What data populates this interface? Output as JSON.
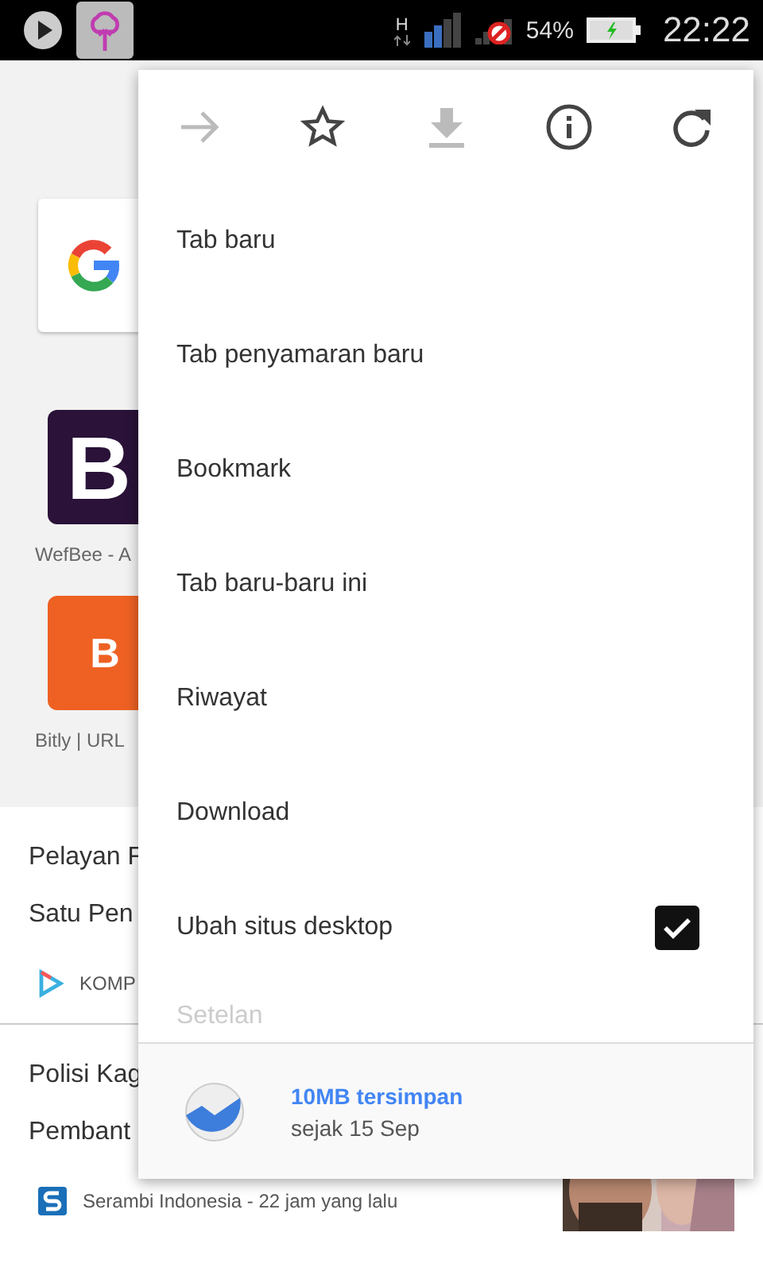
{
  "status_bar": {
    "network": "H",
    "battery": "54%",
    "time": "22:22"
  },
  "tiles": [
    {
      "kind": "google"
    },
    {
      "kind": "letter",
      "letter": "B",
      "color": "#2a1238",
      "label": "WefBee - A"
    },
    {
      "kind": "letter",
      "letter": "B",
      "color": "#ee6123",
      "label": "Bitly | URL"
    }
  ],
  "articles": [
    {
      "lines": [
        "Pelayan F",
        "Satu Pen"
      ],
      "source": "KOMP",
      "kind": "play"
    },
    {
      "lines": [
        "Polisi Kag",
        "Pembant"
      ],
      "source": "Serambi Indonesia - 22 jam yang lalu",
      "kind": "s",
      "thumbnail": {
        "kind": "picture"
      }
    }
  ],
  "menu": {
    "toolbar": [
      {
        "kind": "forward",
        "disabled": true
      },
      {
        "kind": "star",
        "disabled": false
      },
      {
        "kind": "download",
        "disabled": true
      },
      {
        "kind": "info",
        "disabled": false
      },
      {
        "kind": "reload",
        "disabled": false
      }
    ],
    "items": [
      {
        "label": "Tab baru",
        "kind": "plain"
      },
      {
        "label": "Tab penyamaran baru",
        "kind": "plain"
      },
      {
        "label": "Bookmark",
        "kind": "plain"
      },
      {
        "label": "Tab baru-baru ini",
        "kind": "plain"
      },
      {
        "label": "Riwayat",
        "kind": "plain"
      },
      {
        "label": "Download",
        "kind": "plain"
      },
      {
        "label": "Ubah situs desktop",
        "kind": "checkbox",
        "checked": true
      },
      {
        "label": "Setelan",
        "kind": "faded"
      }
    ],
    "footer": {
      "title": "10MB tersimpan",
      "subtitle": "sejak 15 Sep"
    }
  }
}
